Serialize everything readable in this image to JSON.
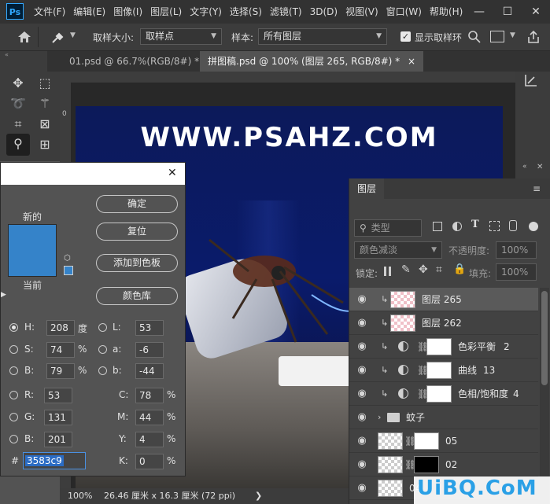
{
  "menubar": {
    "logo": "Ps",
    "items": [
      "文件(F)",
      "编辑(E)",
      "图像(I)",
      "图层(L)",
      "文字(Y)",
      "选择(S)",
      "滤镜(T)",
      "3D(D)",
      "视图(V)",
      "窗口(W)",
      "帮助(H)"
    ],
    "min": "—",
    "max": "☐",
    "close": "✕"
  },
  "options": {
    "sample_size_label": "取样大小:",
    "sample_size_value": "取样点",
    "sample_label": "样本:",
    "sample_value": "所有图层",
    "show_ring_label": "显示取样环"
  },
  "tabs": [
    {
      "label": "01.psd @ 66.7%(RGB/8#) *",
      "close": "×"
    },
    {
      "label": "拼图稿.psd @ 100% (图层 265, RGB/8#) *",
      "close": "×"
    }
  ],
  "canvas": {
    "watermark": "WWW.PSAHZ.COM",
    "ruler_mark": "0"
  },
  "statusbar": {
    "zoom": "100%",
    "doc_size": "26.46 厘米 x 16.3 厘米 (72 ppi)",
    "arrow": "❯"
  },
  "layers": {
    "tab": "图层",
    "filter_placeholder": "类型",
    "blend_mode": "颜色减淡",
    "opacity_label": "不透明度:",
    "opacity_value": "100%",
    "lock_label": "锁定:",
    "fill_label": "填充:",
    "fill_value": "100%",
    "rows": [
      {
        "name": "图层 265"
      },
      {
        "name": "图层 262"
      },
      {
        "name": "色彩平衡",
        "num": "2"
      },
      {
        "name": "曲线",
        "num": "13"
      },
      {
        "name": "色相/饱和度",
        "num": "4"
      },
      {
        "name": "蚊子"
      },
      {
        "name": "05"
      },
      {
        "name": "02"
      },
      {
        "name": "04"
      }
    ]
  },
  "picker": {
    "new_label": "新的",
    "current_label": "当前",
    "new_color": "#3583c9",
    "current_color": "#3583c9",
    "buttons": {
      "ok": "确定",
      "reset": "复位",
      "add_swatch": "添加到色板",
      "libraries": "颜色库"
    },
    "hsb": [
      {
        "label": "H:",
        "value": "208",
        "unit": "度",
        "selected": true
      },
      {
        "label": "S:",
        "value": "74",
        "unit": "%"
      },
      {
        "label": "B:",
        "value": "79",
        "unit": "%"
      }
    ],
    "lab": [
      {
        "label": "L:",
        "value": "53"
      },
      {
        "label": "a:",
        "value": "-6"
      },
      {
        "label": "b:",
        "value": "-44"
      }
    ],
    "rgb": [
      {
        "label": "R:",
        "value": "53"
      },
      {
        "label": "G:",
        "value": "131"
      },
      {
        "label": "B:",
        "value": "201"
      }
    ],
    "cmyk": [
      {
        "label": "C:",
        "value": "78",
        "unit": "%"
      },
      {
        "label": "M:",
        "value": "44",
        "unit": "%"
      },
      {
        "label": "Y:",
        "value": "4",
        "unit": "%"
      },
      {
        "label": "K:",
        "value": "0",
        "unit": "%"
      }
    ],
    "hex_label": "#",
    "hex_value": "3583c9",
    "close": "✕"
  },
  "logo": {
    "text": "UiBQ.CoM"
  }
}
